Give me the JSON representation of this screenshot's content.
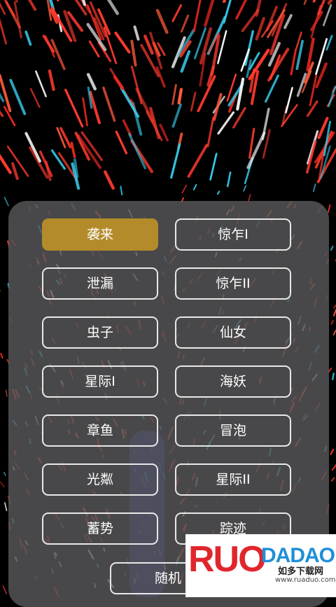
{
  "colors": {
    "selected": "#b38b2a",
    "border": "#e8e8e8",
    "panel": "#58585a",
    "streak_red": "#ff3b2f",
    "streak_cyan": "#36c8e8"
  },
  "options": [
    {
      "label": "袭来",
      "selected": true
    },
    {
      "label": "惊乍I",
      "selected": false
    },
    {
      "label": "泄漏",
      "selected": false
    },
    {
      "label": "惊乍II",
      "selected": false
    },
    {
      "label": "虫子",
      "selected": false
    },
    {
      "label": "仙女",
      "selected": false
    },
    {
      "label": "星际I",
      "selected": false
    },
    {
      "label": "海妖",
      "selected": false
    },
    {
      "label": "章鱼",
      "selected": false
    },
    {
      "label": "冒泡",
      "selected": false
    },
    {
      "label": "光粼",
      "selected": false
    },
    {
      "label": "星际II",
      "selected": false
    },
    {
      "label": "蓄势",
      "selected": false
    },
    {
      "label": "踪迹",
      "selected": false
    }
  ],
  "random_label": "随机",
  "watermark": {
    "logo_left": "RUO",
    "logo_right": "DADAO",
    "cn": "如多下载网",
    "url": "www.ruaduo.com"
  }
}
